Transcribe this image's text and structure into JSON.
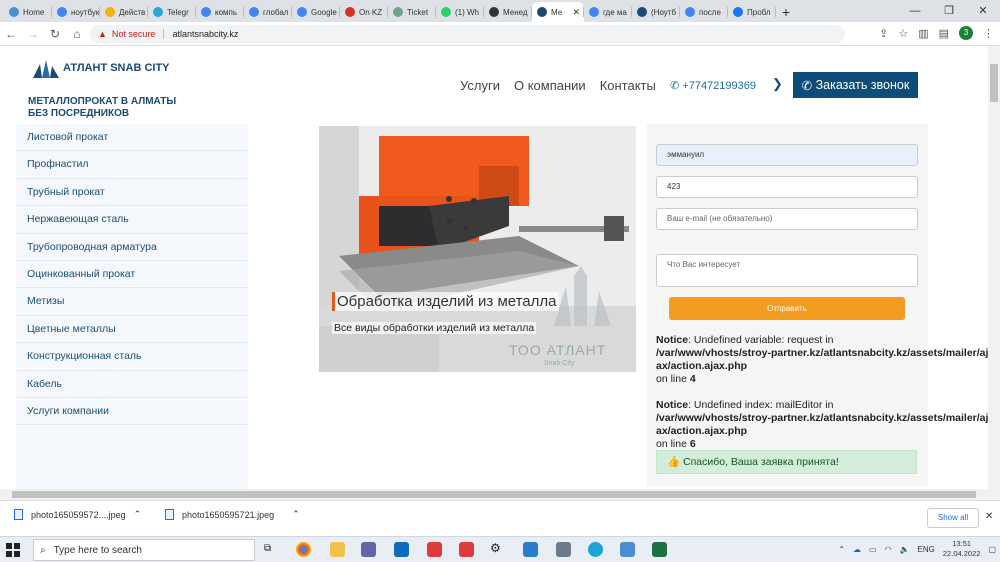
{
  "browser": {
    "tabs": [
      {
        "label": "Home",
        "color": "#4a90d9"
      },
      {
        "label": "ноутбук",
        "color": "#4285f4"
      },
      {
        "label": "Действ",
        "color": "#f4b400"
      },
      {
        "label": "Telegr",
        "color": "#2aa3df"
      },
      {
        "label": "компь",
        "color": "#4285f4"
      },
      {
        "label": "глобал",
        "color": "#4285f4"
      },
      {
        "label": "Google",
        "color": "#4285f4"
      },
      {
        "label": "On KZ",
        "color": "#d93025"
      },
      {
        "label": "Ticket",
        "color": "#6aa88a"
      },
      {
        "label": "(1) Wh",
        "color": "#25d366"
      },
      {
        "label": "Менед",
        "color": "#333333"
      },
      {
        "label": "Ме",
        "color": "#1b4a78",
        "active": true
      },
      {
        "label": "где ма",
        "color": "#4285f4"
      },
      {
        "label": "(Ноутб",
        "color": "#1b4a78"
      },
      {
        "label": "после",
        "color": "#4285f4"
      },
      {
        "label": "Пробл",
        "color": "#1877f2"
      }
    ],
    "security": "Not secure",
    "url": "atlantsnabcity.kz",
    "profile_initial": "3"
  },
  "site": {
    "logo_text": "АТЛАНТ SNAB CITY",
    "tagline_line1": "МЕТАЛЛОПРОКАТ В АЛМАТЫ",
    "tagline_line2": "БЕЗ ПОСРЕДНИКОВ",
    "menu": [
      "Услуги",
      "О компании",
      "Контакты"
    ],
    "phone": "+77472199369",
    "call_button": "Заказать звонок",
    "sidebar": [
      "Листовой прокат",
      "Профнастил",
      "Трубный прокат",
      "Нержавеющая сталь",
      "Трубопроводная арматура",
      "Оцинкованный прокат",
      "Метизы",
      "Цветные металлы",
      "Конструкционная сталь",
      "Кабель",
      "Услуги компании"
    ],
    "slide": {
      "caption": "Обработка изделий из металла",
      "subcaption": "Все виды обработки изделий из металла",
      "watermark": "ТОО АТЛАНТ",
      "watermark_sub": "Snab City"
    },
    "form": {
      "name_value": "эммануил",
      "phone_value": "423",
      "email_placeholder": "Ваш e-mail (не обязательно)",
      "message_placeholder": "Что Вас интересует",
      "submit_label": "Отправить"
    },
    "notices": [
      {
        "label": "Notice",
        "msg": ": Undefined variable: request in",
        "path": "/var/www/vhosts/stroy-partner.kz/atlantsnabcity.kz/assets/mailer/ajax/action.ajax.php",
        "line_prefix": "on line ",
        "line": "4"
      },
      {
        "label": "Notice",
        "msg": ": Undefined index: mailEditor in",
        "path": "/var/www/vhosts/stroy-partner.kz/atlantsnabcity.kz/assets/mailer/ajax/action.ajax.php",
        "line_prefix": "on line ",
        "line": "6"
      }
    ],
    "success": "Спасибо, Ваша заявка принята!"
  },
  "downloads": {
    "files": [
      "photo165059572....jpeg",
      "photo1650595721.jpeg"
    ],
    "show_all": "Show all"
  },
  "taskbar": {
    "search_placeholder": "Type here to search",
    "lang": "ENG",
    "time": "13:51",
    "date": "22.04.2022"
  }
}
